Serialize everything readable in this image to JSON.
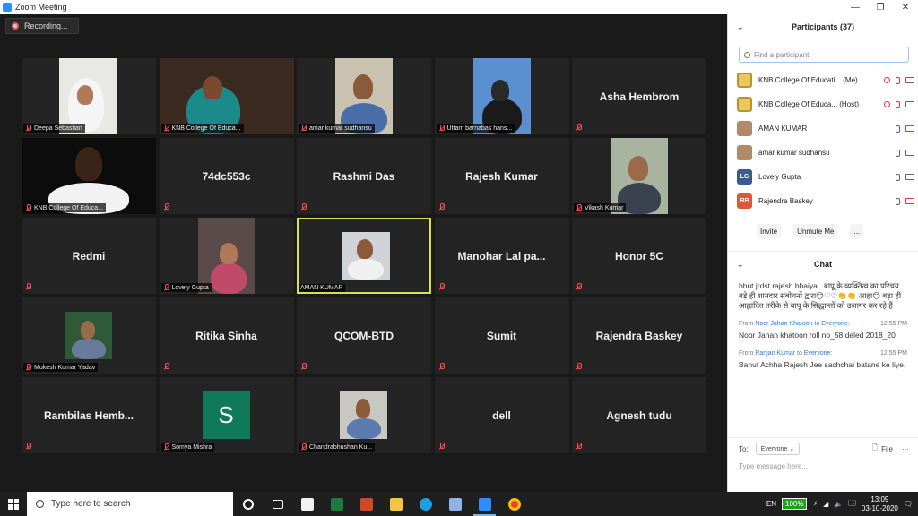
{
  "window": {
    "title": "Zoom Meeting",
    "minimize": "—",
    "maximize": "❐",
    "close": "✕"
  },
  "recording": {
    "label": "Recording..."
  },
  "tiles": [
    {
      "name": "",
      "label": "Deepa Sebastian",
      "photo": "nun"
    },
    {
      "name": "",
      "label": "KNB College Of Educa...",
      "photo": "speech"
    },
    {
      "name": "",
      "label": "amar kumar sudhansu",
      "photo": "man-blue"
    },
    {
      "name": "",
      "label": "Uttam barnabas hans...",
      "photo": "sky"
    },
    {
      "name": "Asha Hembrom",
      "label": ""
    },
    {
      "name": "",
      "label": "KNB College Of Educa...",
      "photo": "man-white"
    },
    {
      "name": "74dc553c",
      "label": ""
    },
    {
      "name": "Rashmi Das",
      "label": ""
    },
    {
      "name": "Rajesh Kumar",
      "label": ""
    },
    {
      "name": "",
      "label": "Vikash Kumar",
      "photo": "man-outdoor"
    },
    {
      "name": "Redmi",
      "label": ""
    },
    {
      "name": "",
      "label": "Lovely Gupta",
      "photo": "woman"
    },
    {
      "name": "",
      "label": "AMAN KUMAR",
      "photo": "man-shirt",
      "active": true
    },
    {
      "name": "Manohar Lal pa...",
      "label": ""
    },
    {
      "name": "Honor 5C",
      "label": ""
    },
    {
      "name": "",
      "label": "Mukesh Kumar Yadav",
      "photo": "man-green"
    },
    {
      "name": "Ritika Sinha",
      "label": ""
    },
    {
      "name": "QCOM-BTD",
      "label": ""
    },
    {
      "name": "Sumit",
      "label": ""
    },
    {
      "name": "Rajendra Baskey",
      "label": ""
    },
    {
      "name": "Rambilas  Hemb...",
      "label": ""
    },
    {
      "name": "",
      "label": "Somya Mishra",
      "photo": "letter-s",
      "letter": "S"
    },
    {
      "name": "",
      "label": "Chandrabhushan Ku...",
      "photo": "man-shirt2"
    },
    {
      "name": "dell",
      "label": ""
    },
    {
      "name": "Agnesh tudu",
      "label": ""
    }
  ],
  "participants": {
    "title": "Participants (37)",
    "search_placeholder": "Find a participant",
    "list": [
      {
        "name": "KNB College Of Educati... (Me)",
        "avatar": "logo",
        "rec": true,
        "mic": "off",
        "cam": "on"
      },
      {
        "name": "KNB College Of Educa... (Host)",
        "avatar": "logo",
        "rec": true,
        "mic": "off",
        "cam": "on"
      },
      {
        "name": "AMAN KUMAR",
        "avatar": "photo",
        "rec": false,
        "mic": "on",
        "cam": "off"
      },
      {
        "name": "amar kumar sudhansu",
        "avatar": "photo",
        "rec": false,
        "mic": "on",
        "cam": "on"
      },
      {
        "name": "Lovely Gupta",
        "avatar": "LG",
        "avatar_color": "#3b5a8f",
        "rec": false,
        "mic": "on",
        "cam": "on"
      },
      {
        "name": "Rajendra Baskey",
        "avatar": "RB",
        "avatar_color": "#e0563a",
        "rec": false,
        "mic": "on",
        "cam": "off"
      }
    ],
    "invite": "Invite",
    "unmute": "Unmute Me",
    "more": "..."
  },
  "chat": {
    "title": "Chat",
    "first_message": "bhut jrdst rajesh bhaiya...बापू के व्यक्तित्व का परिचय बड़े ही शानदार संबोधनों द्वारा😊♡♡👏👏 आहा😊 बड़ा ही आह्लादित तरीके से बापू के सिद्धान्तों को उजागर कर रहे हैं",
    "messages": [
      {
        "from_prefix": "From",
        "sender": "Noor Jahan Khatoon",
        "to_word": "to",
        "recipient": "Everyone:",
        "time": "12:55 PM",
        "text": "Noor Jahan khatoon roll no_58 deled 2018_20"
      },
      {
        "from_prefix": "From",
        "sender": "Ranjan Kumar",
        "to_word": "to",
        "recipient": "Everyone:",
        "time": "12:55 PM",
        "text": "Bahut Achha Rajesh Jee sachchai batane ke liye."
      }
    ],
    "to_label": "To:",
    "to_value": "Everyone",
    "file_label": "File",
    "more": "···",
    "input_placeholder": "Type message here..."
  },
  "taskbar": {
    "search_placeholder": "Type here to search",
    "lang": "EN",
    "battery": "100%",
    "time": "13:09",
    "date": "03-10-2020"
  }
}
